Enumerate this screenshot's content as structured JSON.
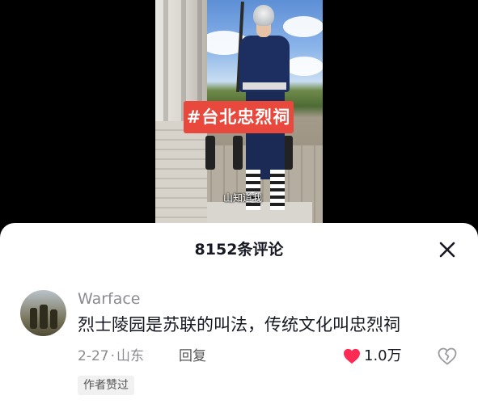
{
  "video": {
    "hashtag": "#台北忠烈祠",
    "subtitle": "山知道我"
  },
  "comments_panel": {
    "title": "8152条评论",
    "close_icon": "close-icon"
  },
  "comment": {
    "username": "Warface",
    "text": "烈士陵园是苏联的叫法，传统文化叫忠烈祠",
    "date": "2-27",
    "separator": "·",
    "location": "山东",
    "reply_label": "回复",
    "likes": "1.0万",
    "liked": true,
    "like_color": "#fe2c55",
    "author_badge": "作者赞过",
    "like_icon": "heart-icon",
    "dislike_icon": "broken-heart-icon"
  }
}
